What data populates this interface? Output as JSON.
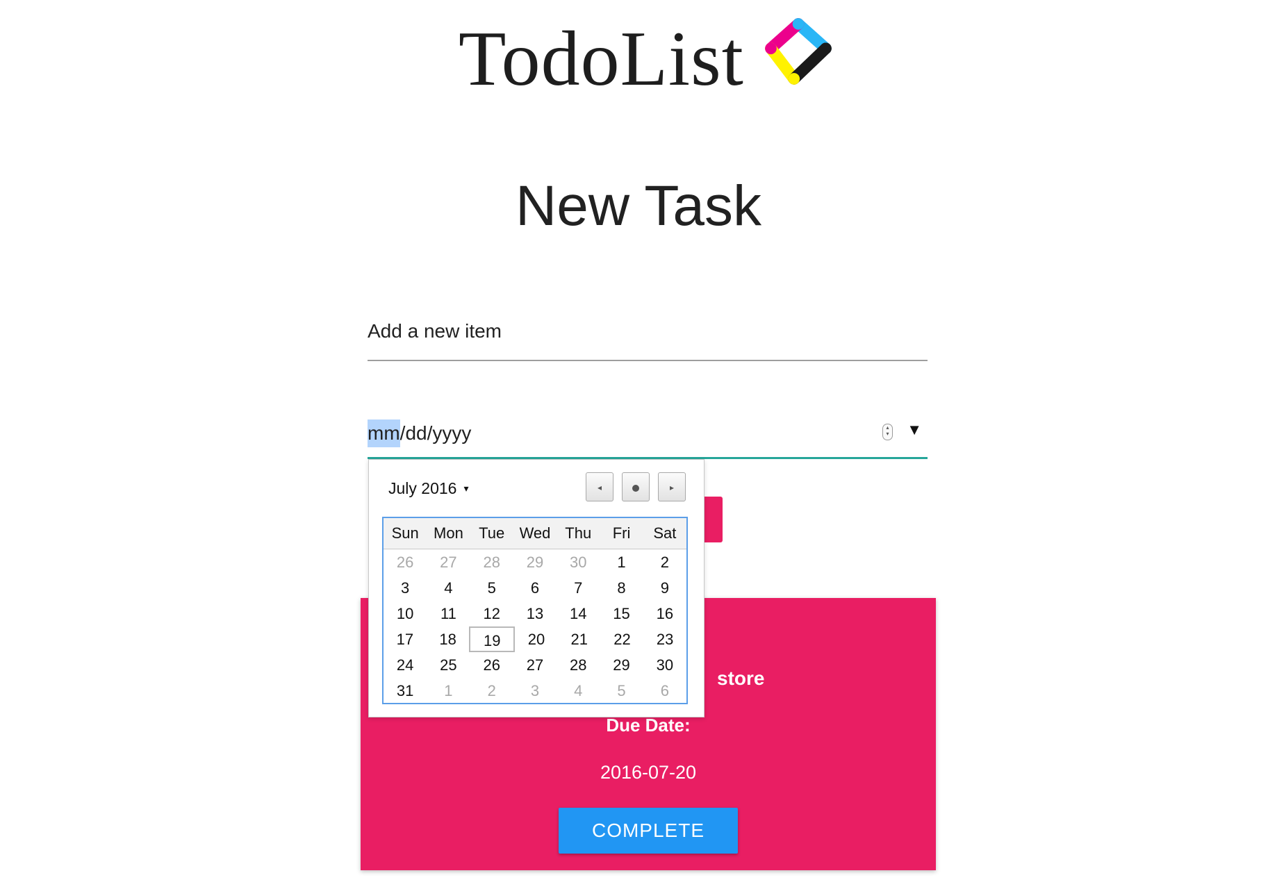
{
  "logo": {
    "text": "TodoList",
    "mark_colors": [
      "#29b6f6",
      "#ec008c",
      "#fff200",
      "#1a1a1a"
    ]
  },
  "page": {
    "title": "New Task"
  },
  "item_input": {
    "placeholder": "Add a new item"
  },
  "date_input": {
    "month_segment": "mm",
    "separator1": "/",
    "day_segment": "dd",
    "separator2": "/",
    "year_segment": "yyyy",
    "spinner_icon": "spinner-icon",
    "dropdown_icon": "dropdown-arrow-icon",
    "accent_color": "#26a69a"
  },
  "calendar": {
    "month_label": "July 2016",
    "month_caret": "▾",
    "prev_icon": "◂",
    "next_icon": "▸",
    "weekdays": [
      "Sun",
      "Mon",
      "Tue",
      "Wed",
      "Thu",
      "Fri",
      "Sat"
    ],
    "weeks": [
      [
        {
          "d": "26",
          "m": true
        },
        {
          "d": "27",
          "m": true
        },
        {
          "d": "28",
          "m": true
        },
        {
          "d": "29",
          "m": true
        },
        {
          "d": "30",
          "m": true
        },
        {
          "d": "1"
        },
        {
          "d": "2"
        }
      ],
      [
        {
          "d": "3"
        },
        {
          "d": "4"
        },
        {
          "d": "5"
        },
        {
          "d": "6"
        },
        {
          "d": "7"
        },
        {
          "d": "8"
        },
        {
          "d": "9"
        }
      ],
      [
        {
          "d": "10"
        },
        {
          "d": "11"
        },
        {
          "d": "12"
        },
        {
          "d": "13"
        },
        {
          "d": "14"
        },
        {
          "d": "15"
        },
        {
          "d": "16"
        }
      ],
      [
        {
          "d": "17"
        },
        {
          "d": "18"
        },
        {
          "d": "19",
          "today": true
        },
        {
          "d": "20"
        },
        {
          "d": "21"
        },
        {
          "d": "22"
        },
        {
          "d": "23"
        }
      ],
      [
        {
          "d": "24"
        },
        {
          "d": "25"
        },
        {
          "d": "26"
        },
        {
          "d": "27"
        },
        {
          "d": "28"
        },
        {
          "d": "29"
        },
        {
          "d": "30"
        }
      ],
      [
        {
          "d": "31"
        },
        {
          "d": "1",
          "m": true
        },
        {
          "d": "2",
          "m": true
        },
        {
          "d": "3",
          "m": true
        },
        {
          "d": "4",
          "m": true
        },
        {
          "d": "5",
          "m": true
        },
        {
          "d": "6",
          "m": true
        }
      ]
    ]
  },
  "task_card": {
    "name_visible_fragment": "store",
    "due_label": "Due Date:",
    "due_value": "2016-07-20",
    "complete_label": "COMPLETE",
    "card_color": "#e91e63",
    "button_color": "#2196f3"
  }
}
